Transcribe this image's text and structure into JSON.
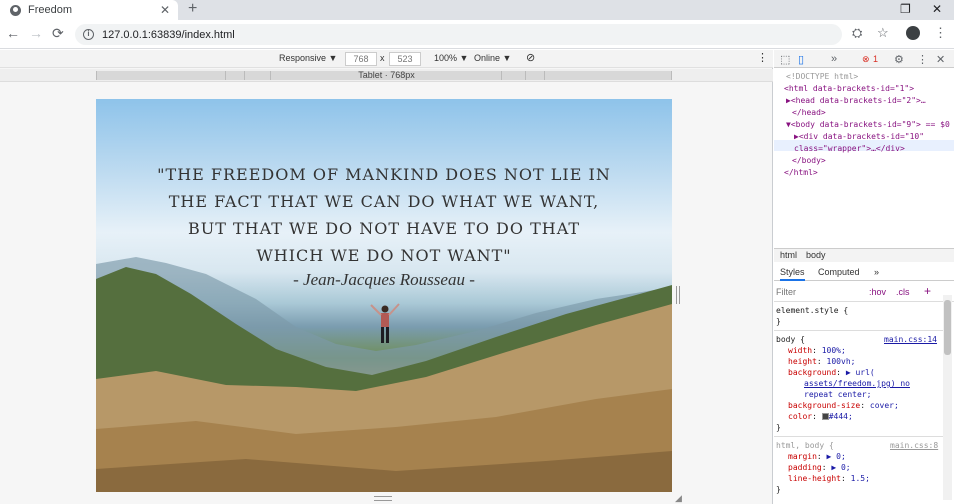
{
  "browser": {
    "tab_title": "Freedom",
    "tab_close": "✕",
    "new_tab": "+",
    "url": "127.0.0.1:63839/index.html",
    "back": "←",
    "forward": "→",
    "reload": "⟳"
  },
  "device_toolbar": {
    "mode": "Responsive ▼",
    "width": "768",
    "height": "523",
    "times": "x",
    "zoom": "100% ▼",
    "network": "Online ▼",
    "media_label": "Tablet · 768px"
  },
  "page": {
    "quote": "\"The freedom of mankind does not lie in the fact that we can do what we want, but that we do not have to do that which we do not want\"",
    "author": "- Jean-Jacques Rousseau -"
  },
  "devtools": {
    "elements": [
      "<!DOCTYPE html>",
      "<html data-brackets-id=\"1\">",
      "▶<head data-brackets-id=\"2\">…",
      "</head>",
      "▼<body data-brackets-id=\"9\"> == $0",
      "▶<div data-brackets-id=\"10\"",
      "class=\"wrapper\">…</div>",
      "</body>",
      "</html>"
    ],
    "breadcrumbs": [
      "html",
      "body"
    ],
    "tabs": [
      "Styles",
      "Computed",
      "»"
    ],
    "filter_placeholder": "Filter",
    "hov": ":hov",
    "cls": ".cls",
    "plus": "+",
    "error_count": "1",
    "styles": {
      "element_style": "element.style {",
      "body_selector": "body {",
      "body_source": "main.css:14",
      "body_props": [
        {
          "name": "width",
          "value": "100%;"
        },
        {
          "name": "height",
          "value": "100vh;"
        },
        {
          "name": "background",
          "value": "▶ url("
        },
        {
          "name": "",
          "value": "assets/freedom.jpg) no"
        },
        {
          "name": "",
          "value": "repeat center;"
        },
        {
          "name": "background-size",
          "value": "cover;"
        },
        {
          "name": "color",
          "value": "#444;"
        }
      ],
      "html_body_selector": "html, body {",
      "html_body_source": "main.css:8",
      "html_body_props": [
        {
          "name": "margin",
          "value": "▶ 0;"
        },
        {
          "name": "padding",
          "value": "▶ 0;"
        },
        {
          "name": "line-height",
          "value": "1.5;"
        }
      ]
    }
  }
}
